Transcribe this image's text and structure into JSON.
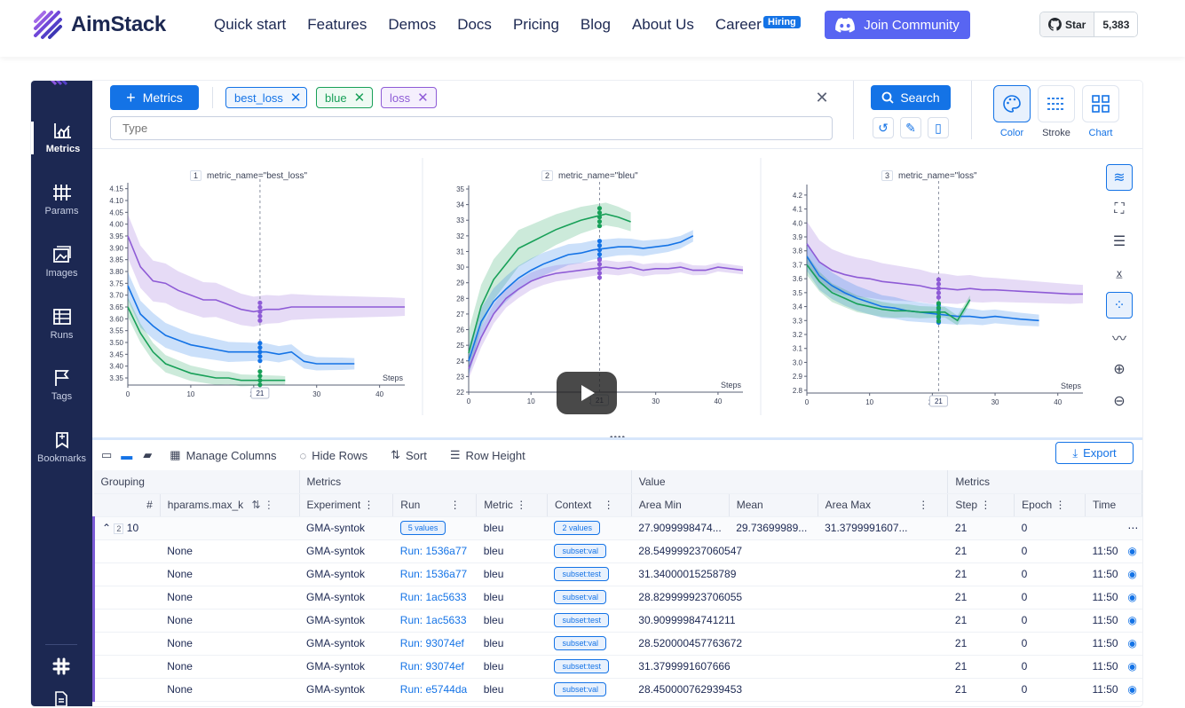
{
  "site": {
    "brand": "AimStack",
    "nav": [
      "Quick start",
      "Features",
      "Demos",
      "Docs",
      "Pricing",
      "Blog",
      "About Us",
      "Career"
    ],
    "hiring_badge": "Hiring",
    "join_label": "Join Community",
    "github": {
      "star_label": "Star",
      "count": "5,383"
    }
  },
  "sidebar": {
    "items": [
      {
        "label": "Metrics",
        "icon": "line-chart-icon"
      },
      {
        "label": "Params",
        "icon": "params-icon"
      },
      {
        "label": "Images",
        "icon": "images-icon"
      },
      {
        "label": "Runs",
        "icon": "table-icon"
      },
      {
        "label": "Tags",
        "icon": "flag-icon"
      },
      {
        "label": "Bookmarks",
        "icon": "bookmark-icon"
      }
    ]
  },
  "toolbar": {
    "metrics_button": "Metrics",
    "chips": [
      {
        "label": "best_loss",
        "color": "#1473e6"
      },
      {
        "label": "blue",
        "color": "#18a058"
      },
      {
        "label": "loss",
        "color": "#8e5bd6"
      }
    ],
    "type_placeholder": "Type",
    "search_button": "Search",
    "vis": {
      "color": "Color",
      "stroke": "Stroke",
      "chart": "Chart"
    }
  },
  "charts": {
    "titles": [
      {
        "num": "1",
        "text": "metric_name=\"best_loss\""
      },
      {
        "num": "2",
        "text": "metric_name=\"bleu\""
      },
      {
        "num": "3",
        "text": "metric_name=\"loss\""
      }
    ],
    "steps_label": "Steps",
    "cursor_step": "21",
    "chart_data": [
      {
        "type": "line",
        "title": "metric_name=\"best_loss\"",
        "xlabel": "Steps",
        "x_ticks": [
          "0",
          "10",
          "20",
          "30",
          "40"
        ],
        "y_ticks": [
          "3.35",
          "3.40",
          "3.45",
          "3.50",
          "3.55",
          "3.60",
          "3.65",
          "3.70",
          "3.75",
          "3.80",
          "3.85",
          "3.90",
          "3.95",
          "4.00",
          "4.05",
          "4.10",
          "4.15"
        ],
        "xlim": [
          0,
          44
        ],
        "ylim": [
          3.32,
          4.16
        ],
        "series": [
          {
            "color": "#8e5bd6",
            "x": [
              0,
              2,
              4,
              6,
              8,
              10,
              12,
              14,
              16,
              18,
              20,
              22,
              24,
              26,
              28,
              30,
              34,
              38,
              42,
              44
            ],
            "y": [
              3.95,
              3.82,
              3.76,
              3.75,
              3.72,
              3.7,
              3.68,
              3.68,
              3.66,
              3.64,
              3.63,
              3.64,
              3.64,
              3.65,
              3.65,
              3.65,
              3.65,
              3.65,
              3.65,
              3.65
            ]
          },
          {
            "color": "#1473e6",
            "x": [
              0,
              2,
              4,
              6,
              8,
              10,
              12,
              14,
              16,
              18,
              20,
              22,
              24,
              26,
              28,
              30,
              34,
              36
            ],
            "y": [
              3.74,
              3.62,
              3.57,
              3.53,
              3.51,
              3.49,
              3.48,
              3.47,
              3.46,
              3.46,
              3.46,
              3.46,
              3.45,
              3.46,
              3.42,
              3.41,
              3.41,
              3.41
            ]
          },
          {
            "color": "#18a058",
            "x": [
              0,
              2,
              4,
              6,
              8,
              10,
              12,
              14,
              16,
              18,
              20,
              22,
              24,
              25
            ],
            "y": [
              3.65,
              3.54,
              3.46,
              3.41,
              3.39,
              3.37,
              3.36,
              3.35,
              3.35,
              3.34,
              3.34,
              3.34,
              3.34,
              3.34
            ]
          }
        ]
      },
      {
        "type": "line",
        "title": "metric_name=\"bleu\"",
        "xlabel": "Steps",
        "x_ticks": [
          "0",
          "10",
          "20",
          "30",
          "40"
        ],
        "y_ticks": [
          "22",
          "23",
          "24",
          "25",
          "26",
          "27",
          "28",
          "29",
          "30",
          "31",
          "32",
          "33",
          "34",
          "35"
        ],
        "xlim": [
          0,
          44
        ],
        "ylim": [
          22,
          35
        ],
        "series": [
          {
            "color": "#18a058",
            "x": [
              0,
              2,
              4,
              6,
              8,
              10,
              12,
              14,
              16,
              18,
              20,
              22,
              24,
              26
            ],
            "y": [
              24.5,
              27.5,
              29.2,
              30.2,
              31.2,
              31.6,
              32.0,
              32.4,
              32.7,
              33.0,
              33.2,
              33.4,
              33.2,
              32.9
            ]
          },
          {
            "color": "#1473e6",
            "x": [
              0,
              2,
              4,
              6,
              8,
              10,
              12,
              14,
              16,
              18,
              20,
              22,
              24,
              26,
              28,
              30,
              32,
              34,
              36
            ],
            "y": [
              24.0,
              26.5,
              27.8,
              28.6,
              29.3,
              29.8,
              30.2,
              30.5,
              30.8,
              30.9,
              31.1,
              31.2,
              31.3,
              31.3,
              31.2,
              31.3,
              31.4,
              31.6,
              32.0
            ]
          },
          {
            "color": "#8e5bd6",
            "x": [
              0,
              2,
              4,
              6,
              8,
              10,
              12,
              14,
              16,
              18,
              20,
              22,
              24,
              26,
              28,
              30,
              32,
              34,
              36,
              38,
              40,
              44
            ],
            "y": [
              23.5,
              25.5,
              27.0,
              28.0,
              28.6,
              29.1,
              29.4,
              29.6,
              29.7,
              29.8,
              29.9,
              30.0,
              29.9,
              30.0,
              29.8,
              29.9,
              29.9,
              30.0,
              29.8,
              29.8,
              30.0,
              29.8
            ]
          }
        ]
      },
      {
        "type": "line",
        "title": "metric_name=\"loss\"",
        "xlabel": "Steps",
        "x_ticks": [
          "0",
          "10",
          "20",
          "30",
          "40"
        ],
        "y_ticks": [
          "2.8",
          "2.9",
          "3.0",
          "3.1",
          "3.2",
          "3.3",
          "3.4",
          "3.5",
          "3.6",
          "3.7",
          "3.8",
          "3.9",
          "4.0",
          "4.1",
          "4.2"
        ],
        "xlim": [
          0,
          44
        ],
        "ylim": [
          2.78,
          4.25
        ],
        "series": [
          {
            "color": "#8e5bd6",
            "x": [
              0,
              2,
              4,
              6,
              8,
              10,
              12,
              14,
              16,
              18,
              20,
              22,
              24,
              26,
              28,
              30,
              34,
              38,
              42,
              44
            ],
            "y": [
              3.85,
              3.72,
              3.66,
              3.63,
              3.61,
              3.6,
              3.58,
              3.57,
              3.56,
              3.55,
              3.53,
              3.53,
              3.52,
              3.53,
              3.52,
              3.52,
              3.51,
              3.5,
              3.49,
              3.49
            ]
          },
          {
            "color": "#1473e6",
            "x": [
              0,
              2,
              4,
              6,
              8,
              10,
              12,
              14,
              16,
              18,
              20,
              22,
              24,
              26,
              28,
              30,
              34,
              37
            ],
            "y": [
              3.76,
              3.62,
              3.55,
              3.5,
              3.46,
              3.43,
              3.4,
              3.39,
              3.37,
              3.36,
              3.35,
              3.34,
              3.33,
              3.33,
              3.32,
              3.33,
              3.31,
              3.3
            ]
          },
          {
            "color": "#18a058",
            "x": [
              0,
              2,
              4,
              6,
              8,
              10,
              12,
              14,
              16,
              18,
              20,
              22,
              24,
              26
            ],
            "y": [
              3.7,
              3.58,
              3.5,
              3.46,
              3.42,
              3.4,
              3.38,
              3.37,
              3.37,
              3.36,
              3.36,
              3.36,
              3.3,
              3.45
            ]
          }
        ]
      }
    ]
  },
  "table_toolbar": {
    "manage_columns": "Manage Columns",
    "hide_rows": "Hide Rows",
    "sort": "Sort",
    "row_height": "Row Height",
    "export": "Export"
  },
  "table": {
    "groups": [
      "Grouping",
      "Metrics",
      "Value",
      "Metrics"
    ],
    "headers": [
      "#",
      "hparams.max_k",
      "Experiment",
      "Run",
      "Metric",
      "Context",
      "Area Min",
      "Mean",
      "Area Max",
      "Step",
      "Epoch",
      "Time"
    ],
    "group_row": {
      "count": "2",
      "value": "10",
      "experiment": "GMA-syntok",
      "run": "5 values",
      "metric": "bleu",
      "context": "2 values",
      "area_min": "27.9099998474...",
      "mean": "29.73699989...",
      "area_max": "31.3799991607...",
      "step": "21",
      "epoch": "0"
    },
    "rows": [
      {
        "max_k": "None",
        "experiment": "GMA-syntok",
        "run": "Run: 1536a77",
        "metric": "bleu",
        "context": "subset:val",
        "value": "28.549999237060547",
        "step": "21",
        "epoch": "0",
        "time": "11:50"
      },
      {
        "max_k": "None",
        "experiment": "GMA-syntok",
        "run": "Run: 1536a77",
        "metric": "bleu",
        "context": "subset:test",
        "value": "31.34000015258789",
        "step": "21",
        "epoch": "0",
        "time": "11:50"
      },
      {
        "max_k": "None",
        "experiment": "GMA-syntok",
        "run": "Run: 1ac5633",
        "metric": "bleu",
        "context": "subset:val",
        "value": "28.829999923706055",
        "step": "21",
        "epoch": "0",
        "time": "11:50"
      },
      {
        "max_k": "None",
        "experiment": "GMA-syntok",
        "run": "Run: 1ac5633",
        "metric": "bleu",
        "context": "subset:test",
        "value": "30.90999984741211",
        "step": "21",
        "epoch": "0",
        "time": "11:50"
      },
      {
        "max_k": "None",
        "experiment": "GMA-syntok",
        "run": "Run: 93074ef",
        "metric": "bleu",
        "context": "subset:val",
        "value": "28.520000457763672",
        "step": "21",
        "epoch": "0",
        "time": "11:50"
      },
      {
        "max_k": "None",
        "experiment": "GMA-syntok",
        "run": "Run: 93074ef",
        "metric": "bleu",
        "context": "subset:test",
        "value": "31.3799991607666",
        "step": "21",
        "epoch": "0",
        "time": "11:50"
      },
      {
        "max_k": "None",
        "experiment": "GMA-syntok",
        "run": "Run: e5744da",
        "metric": "bleu",
        "context": "subset:val",
        "value": "28.450000762939453",
        "step": "21",
        "epoch": "0",
        "time": "11:50"
      }
    ]
  }
}
